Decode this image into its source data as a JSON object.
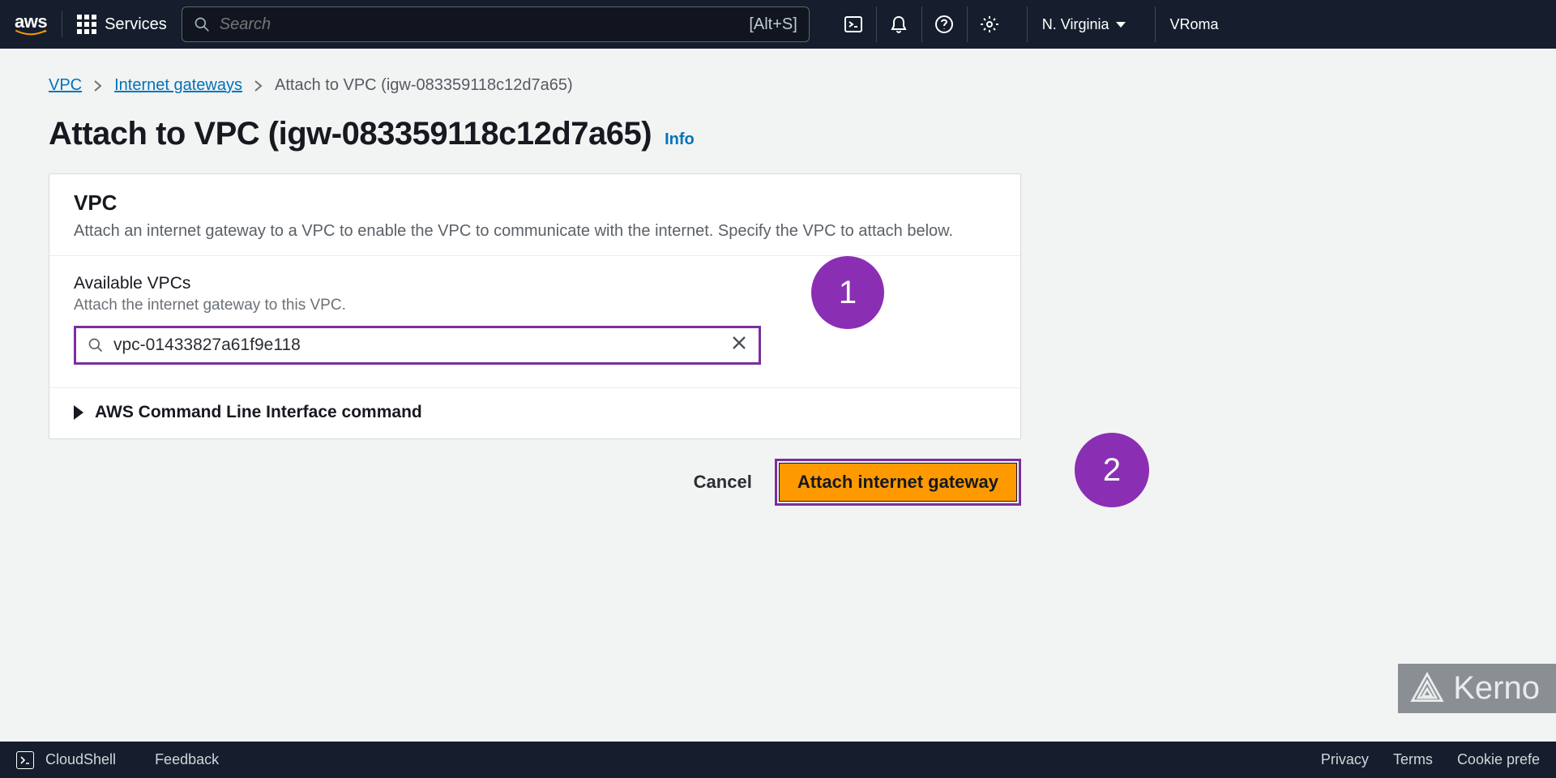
{
  "topnav": {
    "logo_text": "aws",
    "services_label": "Services",
    "search_placeholder": "Search",
    "search_shortcut": "[Alt+S]",
    "region": "N. Virginia",
    "user": "VRoma"
  },
  "breadcrumb": {
    "items": [
      {
        "label": "VPC",
        "link": true
      },
      {
        "label": "Internet gateways",
        "link": true
      },
      {
        "label": "Attach to VPC (igw-083359118c12d7a65)",
        "link": false
      }
    ]
  },
  "page": {
    "title": "Attach to VPC (igw-083359118c12d7a65)",
    "info": "Info"
  },
  "panel": {
    "heading": "VPC",
    "description": "Attach an internet gateway to a VPC to enable the VPC to communicate with the internet. Specify the VPC to attach below.",
    "field_label": "Available VPCs",
    "field_help": "Attach the internet gateway to this VPC.",
    "vpc_value": "vpc-01433827a61f9e118",
    "cli_toggle": "AWS Command Line Interface command"
  },
  "actions": {
    "cancel": "Cancel",
    "attach": "Attach internet gateway"
  },
  "annotations": {
    "badge1": "1",
    "badge2": "2"
  },
  "kerno": {
    "label": "Kerno"
  },
  "footer": {
    "cloudshell": "CloudShell",
    "feedback": "Feedback",
    "privacy": "Privacy",
    "terms": "Terms",
    "cookie": "Cookie prefe"
  }
}
